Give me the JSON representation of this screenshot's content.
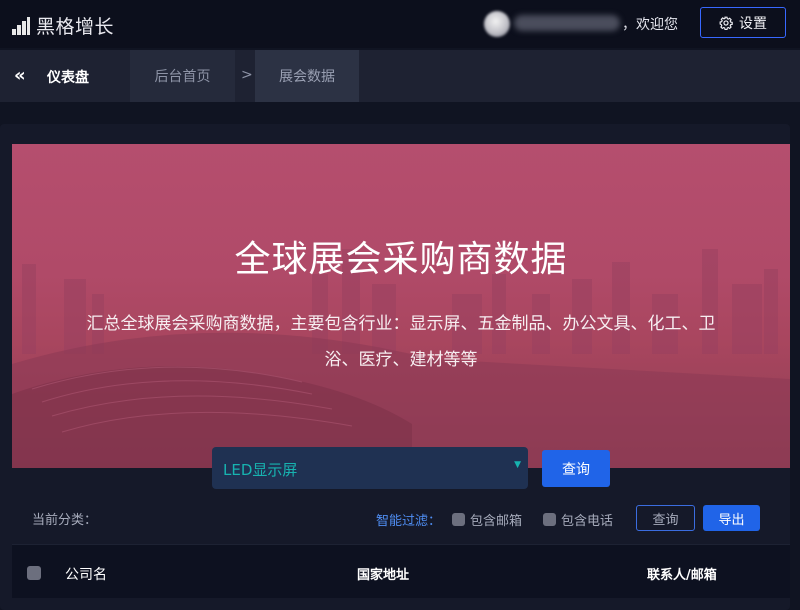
{
  "app": {
    "name": "黑格增长"
  },
  "header": {
    "welcome_suffix": "，欢迎您",
    "settings_label": "设置"
  },
  "breadcrumb": {
    "dashboard_label": "仪表盘",
    "home": "后台首页",
    "separator": ">",
    "current": "展会数据"
  },
  "hero": {
    "title": "全球展会采购商数据",
    "description": "汇总全球展会采购商数据，主要包含行业：显示屏、五金制品、办公文具、化工、卫浴、医疗、建材等等"
  },
  "search": {
    "selected": "LED显示屏",
    "submit_label": "查询"
  },
  "filters": {
    "current_category_label": "当前分类：",
    "smart_filter_label": "智能过滤：",
    "include_email": "包含邮箱",
    "include_phone": "包含电话",
    "query_label": "查询",
    "export_label": "导出"
  },
  "table": {
    "columns": [
      "公司名",
      "国家地址",
      "联系人/邮箱"
    ]
  },
  "colors": {
    "accent": "#2064e8",
    "hero": "#b04a68",
    "select_text": "#17b3b0",
    "background": "#101422"
  },
  "icons": {
    "logo": "bar-chart-icon",
    "settings": "gear-icon",
    "collapse": "double-chevron-left-icon",
    "select_caret": "caret-down-icon"
  }
}
